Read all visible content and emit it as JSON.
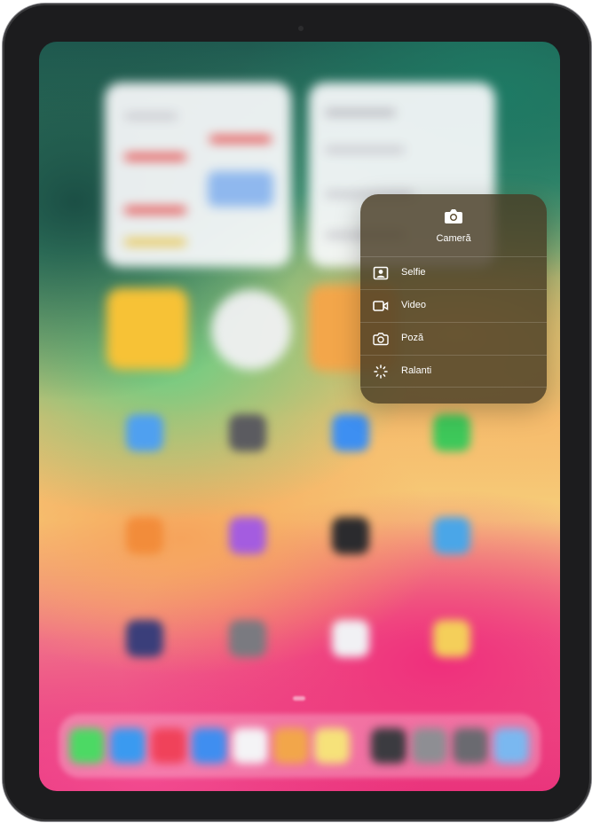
{
  "context_menu": {
    "app_name": "Cameră",
    "app_icon": "camera-icon",
    "actions": [
      {
        "label": "Selfie",
        "icon": "selfie-icon"
      },
      {
        "label": "Video",
        "icon": "video-icon"
      },
      {
        "label": "Poză",
        "icon": "photo-camera-icon"
      },
      {
        "label": "Ralanti",
        "icon": "slow-motion-icon"
      }
    ]
  },
  "colors": {
    "menu_background": "#483c24",
    "menu_text": "#ffffff",
    "device_bezel": "#1c1c1e"
  }
}
